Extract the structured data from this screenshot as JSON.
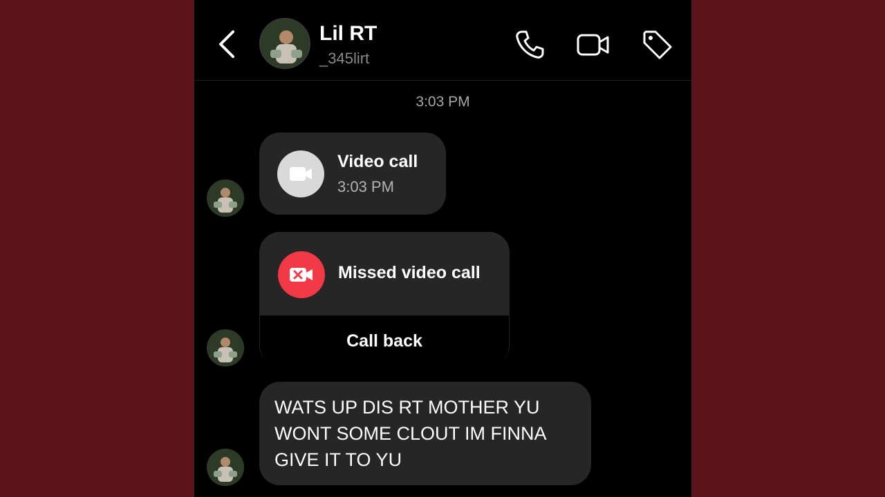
{
  "header": {
    "name": "Lil RT",
    "handle": "_345lirt",
    "icons": [
      "back-icon",
      "phone-icon",
      "video-camera-icon",
      "tag-icon"
    ]
  },
  "thread": {
    "timestamp": "3:03 PM",
    "video_call": {
      "title": "Video call",
      "time": "3:03 PM"
    },
    "missed_call": {
      "title": "Missed video call",
      "action": "Call back"
    },
    "message": "WATS UP DIS RT MOTHER YU WONT SOME CLOUT IM FINNA GIVE IT TO YU"
  },
  "colors": {
    "background": "#5a141a",
    "screen": "#000000",
    "bubble": "#262626",
    "missed_red": "#f23a47",
    "video_gray": "#d9d9d9"
  }
}
